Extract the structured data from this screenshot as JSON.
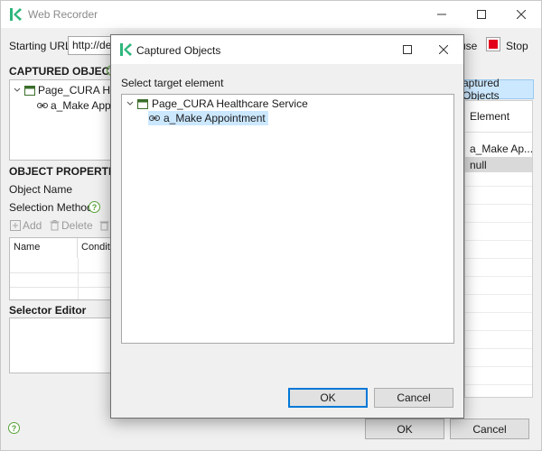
{
  "window": {
    "title": "Web Recorder",
    "controls": {
      "minimize": "minimize",
      "maximize": "maximize",
      "close": "close"
    }
  },
  "toolbar": {
    "starting_url_label": "Starting URL",
    "starting_url_value": "http://de",
    "pause_label": "use",
    "stop_label": "Stop"
  },
  "captured_objects": {
    "heading": "CAPTURED OBJECTS",
    "tree": [
      {
        "label": "Page_CURA Heal",
        "type": "page"
      },
      {
        "label": "a_Make Appo",
        "type": "link"
      }
    ]
  },
  "object_properties": {
    "heading": "OBJECT PROPERTIES",
    "object_name_label": "Object Name",
    "selection_method_label": "Selection Method",
    "help_glyph": "?",
    "add_label": "Add",
    "delete_label": "Delete",
    "table_headers": [
      "Name",
      "Conditi"
    ]
  },
  "selector_editor": {
    "heading": "Selector Editor"
  },
  "right_panel": {
    "tab_label": "aptured Objects",
    "column_header": "Element",
    "rows": [
      "a_Make Ap...",
      "null"
    ]
  },
  "footer": {
    "ok_label": "OK",
    "cancel_label": "Cancel"
  },
  "dialog": {
    "title": "Captured Objects",
    "instruction": "Select target element",
    "tree": [
      {
        "label": "Page_CURA Healthcare Service",
        "type": "page"
      },
      {
        "label": "a_Make Appointment",
        "type": "link",
        "selected": true
      }
    ],
    "ok_label": "OK",
    "cancel_label": "Cancel"
  },
  "colors": {
    "selection": "#cce8ff",
    "accent": "#0078d7",
    "logo_green": "#2db67c",
    "stop_red": "#e3001b"
  }
}
